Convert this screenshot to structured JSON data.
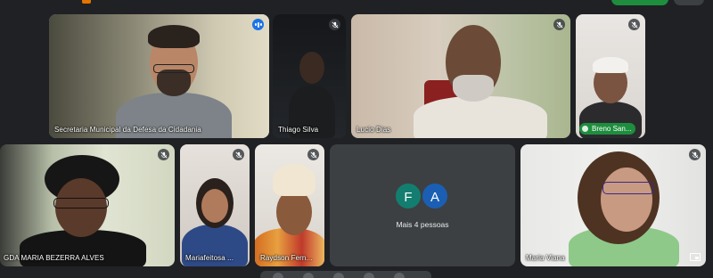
{
  "participants": [
    {
      "name": "Secretaria Municipal da Defesa da Cidadania",
      "mic": "speaking"
    },
    {
      "name": "Thiago Silva",
      "mic": "off"
    },
    {
      "name": "Lucio Dias",
      "mic": "off"
    },
    {
      "name": "Breno San...",
      "mic": "off"
    },
    {
      "name": "GDA MARIA BEZERRA ALVES",
      "mic": "off"
    },
    {
      "name": "Mariafeitosa ...",
      "mic": "off"
    },
    {
      "name": "Raydson Fern...",
      "mic": "off"
    },
    {
      "name": "Maria Viana",
      "mic": "off"
    }
  ],
  "more_participants": {
    "avatars": [
      {
        "initial": "F",
        "color": "#137e6f"
      },
      {
        "initial": "A",
        "color": "#1a5fb4"
      }
    ],
    "label": "Mais 4 pessoas"
  },
  "colors": {
    "background": "#202124",
    "tile": "#3c4043",
    "active_speaker_outline": "#8ab4f8",
    "speaking_indicator": "#1a73e8",
    "presenter_pill": "#1e8e3e"
  }
}
